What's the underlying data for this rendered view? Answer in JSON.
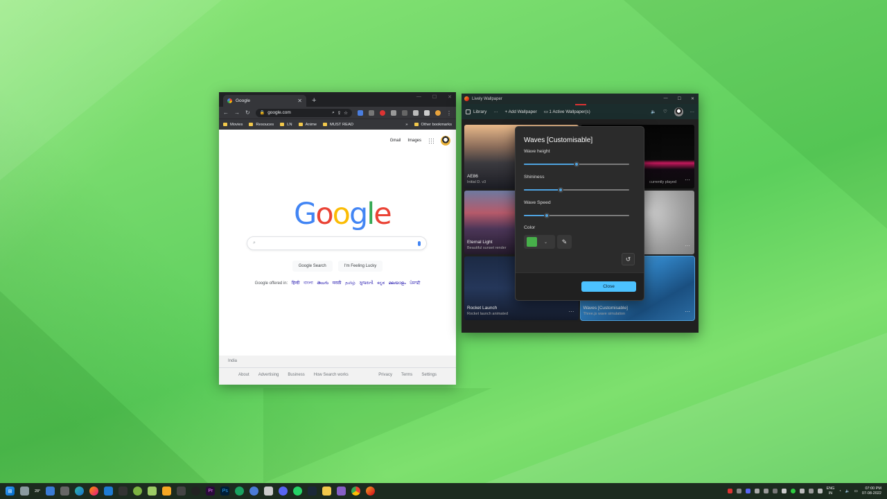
{
  "chrome": {
    "tab_title": "Google",
    "url": "google.com",
    "bookmarks": [
      "Movies",
      "Resouces",
      "LN",
      "Anime",
      "MUST READ"
    ],
    "other_bookmarks": "Other bookmarks",
    "overflow": "»",
    "toplinks": {
      "gmail": "Gmail",
      "images": "Images"
    },
    "logo": [
      "G",
      "o",
      "o",
      "g",
      "l",
      "e"
    ],
    "logo_colors": [
      "#4285f4",
      "#ea4335",
      "#fbbc05",
      "#4285f4",
      "#34a853",
      "#ea4335"
    ],
    "buttons": {
      "search": "Google Search",
      "lucky": "I'm Feeling Lucky"
    },
    "offered_in": "Google offered in:",
    "languages": [
      "हिन्दी",
      "বাংলা",
      "తెలుగు",
      "मराठी",
      "தமிழ்",
      "ગુજરાતી",
      "ಕನ್ನಡ",
      "മലയാളം",
      "ਪੰਜਾਬੀ"
    ],
    "footer": {
      "country": "India",
      "left_links": [
        "About",
        "Advertising",
        "Business",
        "How Search works"
      ],
      "right_links": [
        "Privacy",
        "Terms",
        "Settings"
      ]
    }
  },
  "lively": {
    "title": "Lively Wallpaper",
    "nav": {
      "library": "Library",
      "more": "···",
      "add_wallpaper": "Add Wallpaper",
      "active_wallpapers": "1 Active Wallpaper(s)"
    },
    "cards": [
      {
        "title": "AE86",
        "subtitle": "Initial D. v3"
      },
      {
        "title": "",
        "subtitle": "currently played"
      },
      {
        "title": "Eternal Light",
        "subtitle": "Beautiful sunset render"
      },
      {
        "title": "",
        "subtitle": ""
      },
      {
        "title": "Rocket Launch",
        "subtitle": "Rocket launch animated"
      },
      {
        "title": "Waves [Customisable]",
        "subtitle": "Three.js wave simulation"
      }
    ]
  },
  "dialog": {
    "title": "Waves [Customisable]",
    "wave_height_label": "Wave height",
    "shininess_label": "Shininess",
    "wave_speed_label": "Wave Speed",
    "color_label": "Color",
    "wave_height": 0.5,
    "shininess": 0.35,
    "wave_speed": 0.22,
    "color": "#47b04a",
    "close_label": "Close"
  },
  "taskbar": {
    "weather": "28°",
    "lang_top": "ENG",
    "lang_bottom": "IN",
    "time": "07:00 PM",
    "date": "07-08-2022"
  },
  "colors": {
    "accent": "#4cc2ff",
    "slider_accent": "#4fa3e0",
    "desktop": "#6fd86a"
  }
}
